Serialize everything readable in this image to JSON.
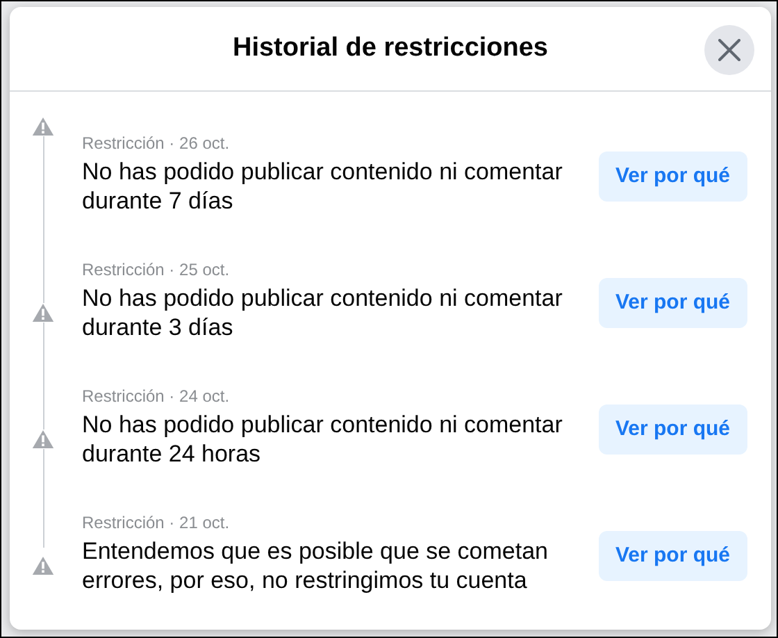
{
  "dialog": {
    "title": "Historial de restricciones"
  },
  "restrictions": [
    {
      "meta": "Restricción · 26 oct.",
      "text": "No has podido publicar contenido ni comentar durante 7 días",
      "button": "Ver por qué"
    },
    {
      "meta": "Restricción · 25 oct.",
      "text": "No has podido publicar contenido ni comentar durante 3 días",
      "button": "Ver por qué"
    },
    {
      "meta": "Restricción · 24 oct.",
      "text": "No has podido publicar contenido ni comentar durante 24 horas",
      "button": "Ver por qué"
    },
    {
      "meta": "Restricción · 21 oct.",
      "text": "Entendemos que es posible que se cometan errores, por eso, no restringimos tu cuenta",
      "button": "Ver por qué"
    }
  ]
}
